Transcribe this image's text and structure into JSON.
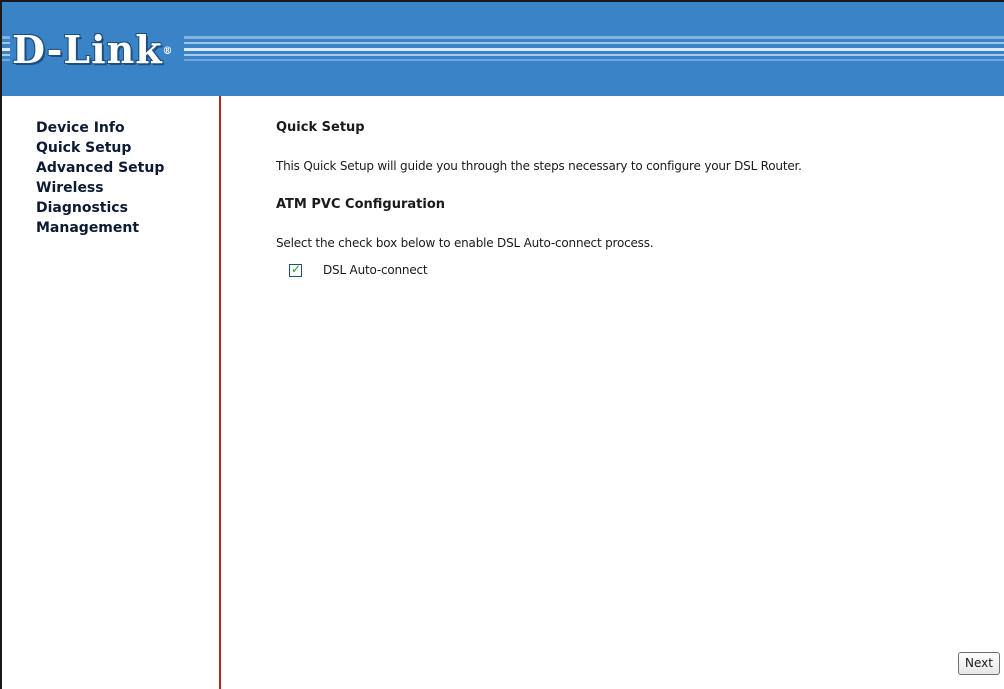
{
  "header": {
    "logo_text": "D-Link",
    "brand_color": "#3a83c7"
  },
  "sidebar": {
    "items": [
      {
        "label": "Device Info"
      },
      {
        "label": "Quick Setup"
      },
      {
        "label": "Advanced Setup"
      },
      {
        "label": "Wireless"
      },
      {
        "label": "Diagnostics"
      },
      {
        "label": "Management"
      }
    ],
    "divider_color": "#b0252a"
  },
  "main": {
    "title": "Quick Setup",
    "intro": "This Quick Setup will guide you through the steps necessary to configure your DSL Router.",
    "section_title": "ATM PVC Configuration",
    "instruction": "Select the check box below to enable DSL Auto-connect process.",
    "auto_connect": {
      "label": "DSL Auto-connect",
      "checked": true
    },
    "next_label": "Next"
  }
}
